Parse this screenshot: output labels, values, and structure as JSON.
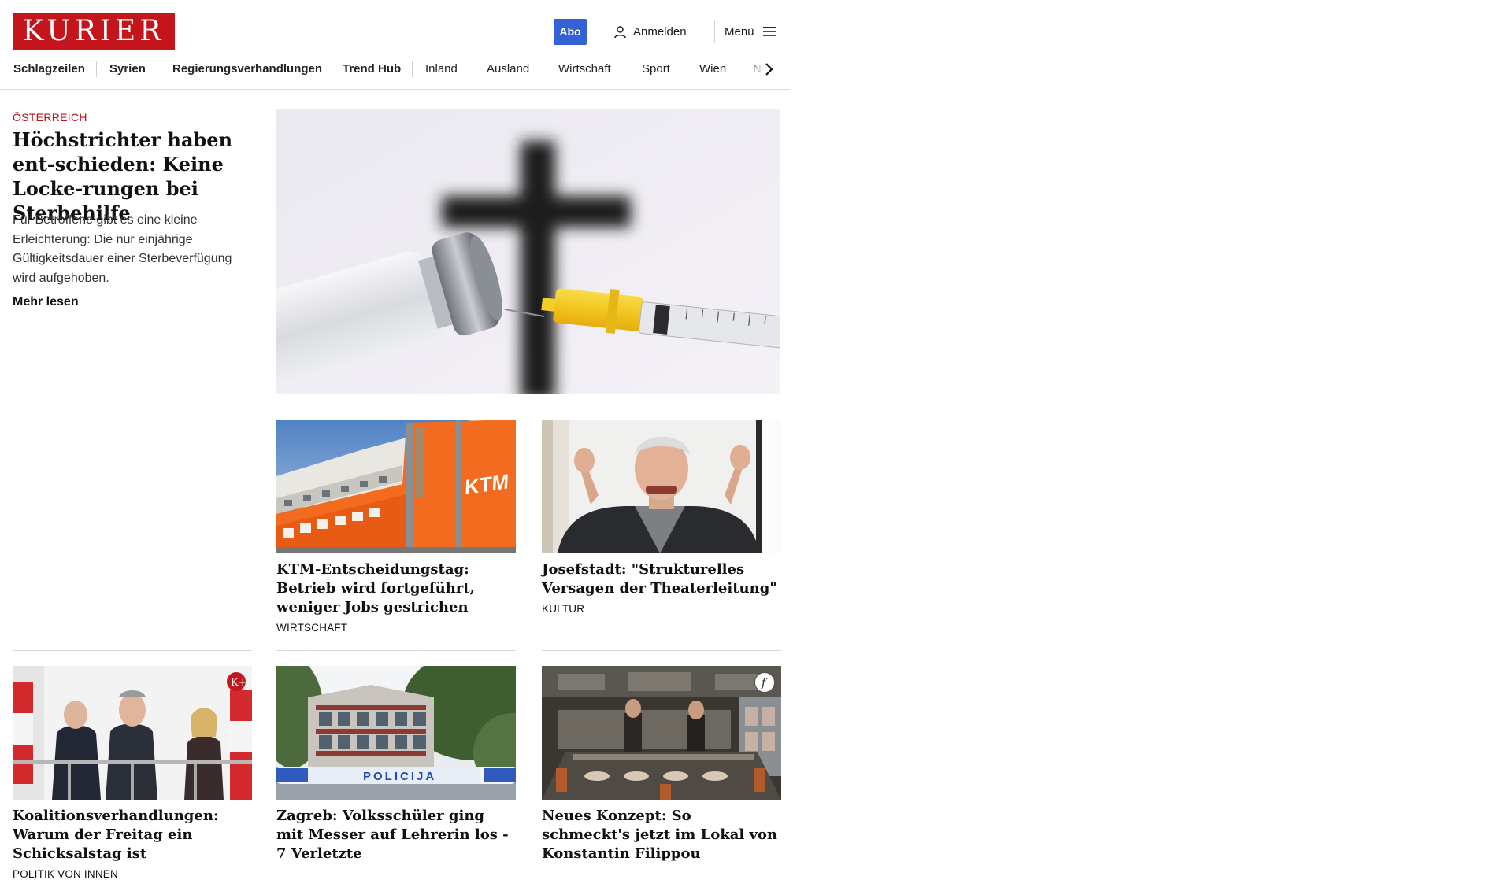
{
  "header": {
    "logo_text": "KURIER",
    "abo_label": "Abo",
    "login_label": "Anmelden",
    "menu_label": "Menü",
    "brand_color": "#c4151c",
    "abo_color": "#3561d6"
  },
  "nav": {
    "items": [
      "Schlagzeilen",
      "Syrien",
      "Regierungsverhandlungen",
      "Trend Hub",
      "Inland",
      "Ausland",
      "Wirtschaft",
      "Sport",
      "Wien",
      "NÖ"
    ]
  },
  "lead": {
    "kicker": "ÖSTERREICH",
    "title": "Höchstrichter haben ent-schieden: Keine Locke-rungen bei Sterbehilfe",
    "teaser": "Für Betroffene gibt es eine kleine Erleichterung: Die nur einjährige Gültigkeitsdauer einer Sterbeverfügung wird aufgehoben.",
    "more_label": "Mehr lesen"
  },
  "cards": [
    {
      "title": "KTM-Entscheidungstag: Betrieb wird fortgeführt, weniger Jobs gestrichen",
      "section": "WIRTSCHAFT"
    },
    {
      "title": "Josefstadt: \"Strukturelles Versagen der Theaterleitung\"",
      "section": "KULTUR"
    },
    {
      "title": "Koalitionsverhandlungen: Warum der Freitag ein Schicksalstag ist",
      "section": "POLITIK VON INNEN",
      "badge": "K+"
    },
    {
      "title": "Zagreb: Volksschüler ging mit Messer auf Lehrerin los - 7 Verletzte",
      "section": ""
    },
    {
      "title": "Neues Konzept: So schmeckt's jetzt im Lokal von Konstantin Filippou",
      "section": "",
      "badge": "f"
    }
  ],
  "images": {
    "ktm_sign": "KTM",
    "police_sign": "POLICIJA"
  }
}
